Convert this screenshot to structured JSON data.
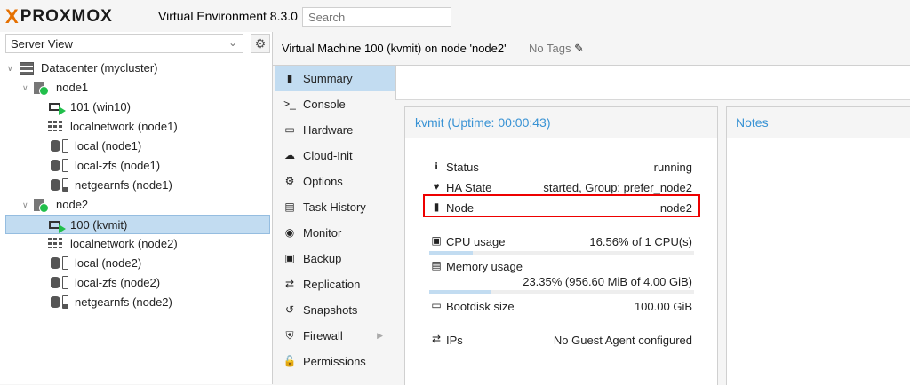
{
  "topbar": {
    "logo_x": "X",
    "logo_text": "PROXMOX",
    "version": "Virtual Environment 8.3.0",
    "search_placeholder": "Search"
  },
  "left": {
    "view_select": "Server View",
    "tree": [
      {
        "label": "Datacenter (mycluster)",
        "icon": "server-icon"
      },
      {
        "label": "node1",
        "icon": "node-online-icon"
      },
      {
        "label": "101 (win10)",
        "icon": "vm-running-icon"
      },
      {
        "label": "localnetwork (node1)",
        "icon": "sdn-grid-icon"
      },
      {
        "label": "local (node1)",
        "icon": "storage-icon"
      },
      {
        "label": "local-zfs (node1)",
        "icon": "storage-icon"
      },
      {
        "label": "netgearnfs (node1)",
        "icon": "storage-nfs-icon"
      },
      {
        "label": "node2",
        "icon": "node-online-icon"
      },
      {
        "label": "100 (kvmit)",
        "icon": "vm-running-icon"
      },
      {
        "label": "localnetwork (node2)",
        "icon": "sdn-grid-icon"
      },
      {
        "label": "local (node2)",
        "icon": "storage-icon"
      },
      {
        "label": "local-zfs (node2)",
        "icon": "storage-icon"
      },
      {
        "label": "netgearnfs (node2)",
        "icon": "storage-nfs-icon"
      }
    ]
  },
  "header": {
    "title": "Virtual Machine 100 (kvmit) on node 'node2'",
    "tags": "No Tags"
  },
  "nav": [
    {
      "label": "Summary",
      "icon": "book-icon"
    },
    {
      "label": "Console",
      "icon": "terminal-icon"
    },
    {
      "label": "Hardware",
      "icon": "desktop-icon"
    },
    {
      "label": "Cloud-Init",
      "icon": "cloud-icon"
    },
    {
      "label": "Options",
      "icon": "gear-icon"
    },
    {
      "label": "Task History",
      "icon": "list-icon"
    },
    {
      "label": "Monitor",
      "icon": "eye-icon"
    },
    {
      "label": "Backup",
      "icon": "floppy-icon"
    },
    {
      "label": "Replication",
      "icon": "retweet-icon"
    },
    {
      "label": "Snapshots",
      "icon": "history-icon"
    },
    {
      "label": "Firewall",
      "icon": "shield-icon"
    },
    {
      "label": "Permissions",
      "icon": "unlock-icon"
    }
  ],
  "status": {
    "title": "kvmit (Uptime: 00:00:43)",
    "rows": {
      "status": {
        "key": "Status",
        "value": "running"
      },
      "ha": {
        "key": "HA State",
        "value": "started, Group: prefer_node2"
      },
      "node": {
        "key": "Node",
        "value": "node2"
      },
      "cpu": {
        "key": "CPU usage",
        "value": "16.56% of 1 CPU(s)",
        "fraction": 0.1656
      },
      "memory": {
        "key": "Memory usage",
        "value": "23.35% (956.60 MiB of 4.00 GiB)",
        "fraction": 0.2335
      },
      "bootdisk": {
        "key": "Bootdisk size",
        "value": "100.00 GiB"
      },
      "ips": {
        "key": "IPs",
        "value": "No Guest Agent configured"
      }
    }
  },
  "notes": {
    "title": "Notes"
  },
  "colors": {
    "accent": "#3892d4",
    "selection": "#c2dcf1",
    "running": "#21bf4b",
    "logo": "#e57000",
    "highlight_border": "#ee0000"
  }
}
